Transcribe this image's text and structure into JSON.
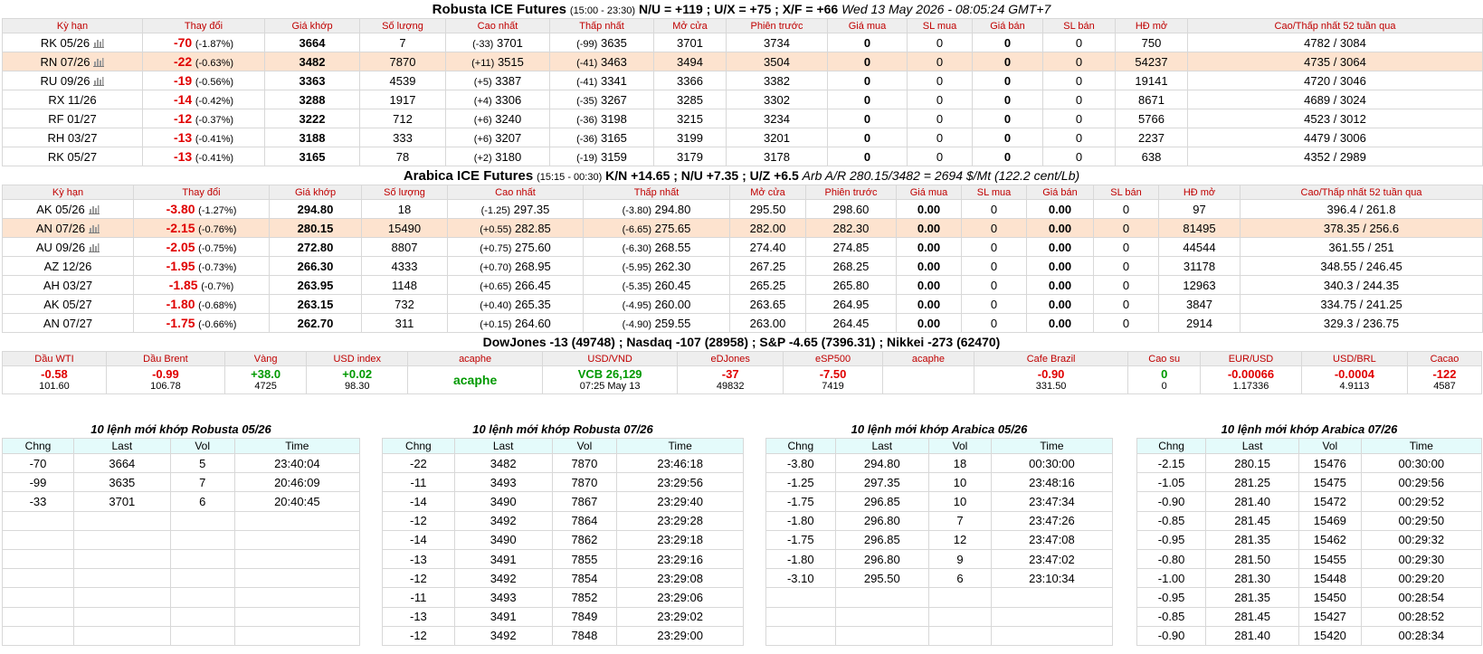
{
  "robusta": {
    "title": "Robusta ICE Futures",
    "hours": "(15:00 - 23:30)",
    "spreads": "N/U = +119 ; U/X = +75 ; X/F = +66",
    "datetime": "Wed 13 May 2026 - 08:05:24 GMT+7",
    "headers": [
      "Kỳ hạn",
      "Thay đổi",
      "Giá khớp",
      "Số lượng",
      "Cao nhất",
      "Thấp nhất",
      "Mở cửa",
      "Phiên trước",
      "Giá mua",
      "SL mua",
      "Giá bán",
      "SL bán",
      "HĐ mở",
      "Cao/Thấp nhất 52 tuần qua"
    ],
    "rows": [
      {
        "term": "RK 05/26",
        "chart": true,
        "chg": "-70",
        "pct": "(-1.87%)",
        "last": "3664",
        "vol": "7",
        "high_d": "(-33)",
        "high": "3701",
        "low_d": "(-99)",
        "low": "3635",
        "open": "3701",
        "prev": "3734",
        "bid": "0",
        "bid_qty": "0",
        "ask": "0",
        "ask_qty": "0",
        "oi": "750",
        "range": "4782 / 3084"
      },
      {
        "term": "RN 07/26",
        "chart": true,
        "chg": "-22",
        "pct": "(-0.63%)",
        "last": "3482",
        "vol": "7870",
        "high_d": "(+11)",
        "high": "3515",
        "low_d": "(-41)",
        "low": "3463",
        "open": "3494",
        "prev": "3504",
        "bid": "0",
        "bid_qty": "0",
        "ask": "0",
        "ask_qty": "0",
        "oi": "54237",
        "range": "4735 / 3064"
      },
      {
        "term": "RU 09/26",
        "chart": true,
        "chg": "-19",
        "pct": "(-0.56%)",
        "last": "3363",
        "vol": "4539",
        "high_d": "(+5)",
        "high": "3387",
        "low_d": "(-41)",
        "low": "3341",
        "open": "3366",
        "prev": "3382",
        "bid": "0",
        "bid_qty": "0",
        "ask": "0",
        "ask_qty": "0",
        "oi": "19141",
        "range": "4720 / 3046"
      },
      {
        "term": "RX 11/26",
        "chart": false,
        "chg": "-14",
        "pct": "(-0.42%)",
        "last": "3288",
        "vol": "1917",
        "high_d": "(+4)",
        "high": "3306",
        "low_d": "(-35)",
        "low": "3267",
        "open": "3285",
        "prev": "3302",
        "bid": "0",
        "bid_qty": "0",
        "ask": "0",
        "ask_qty": "0",
        "oi": "8671",
        "range": "4689 / 3024"
      },
      {
        "term": "RF 01/27",
        "chart": false,
        "chg": "-12",
        "pct": "(-0.37%)",
        "last": "3222",
        "vol": "712",
        "high_d": "(+6)",
        "high": "3240",
        "low_d": "(-36)",
        "low": "3198",
        "open": "3215",
        "prev": "3234",
        "bid": "0",
        "bid_qty": "0",
        "ask": "0",
        "ask_qty": "0",
        "oi": "5766",
        "range": "4523 / 3012"
      },
      {
        "term": "RH 03/27",
        "chart": false,
        "chg": "-13",
        "pct": "(-0.41%)",
        "last": "3188",
        "vol": "333",
        "high_d": "(+6)",
        "high": "3207",
        "low_d": "(-36)",
        "low": "3165",
        "open": "3199",
        "prev": "3201",
        "bid": "0",
        "bid_qty": "0",
        "ask": "0",
        "ask_qty": "0",
        "oi": "2237",
        "range": "4479 / 3006"
      },
      {
        "term": "RK 05/27",
        "chart": false,
        "chg": "-13",
        "pct": "(-0.41%)",
        "last": "3165",
        "vol": "78",
        "high_d": "(+2)",
        "high": "3180",
        "low_d": "(-19)",
        "low": "3159",
        "open": "3179",
        "prev": "3178",
        "bid": "0",
        "bid_qty": "0",
        "ask": "0",
        "ask_qty": "0",
        "oi": "638",
        "range": "4352 / 2989"
      }
    ]
  },
  "arabica": {
    "title": "Arabica ICE Futures",
    "hours": "(15:15 - 00:30)",
    "spreads": "K/N +14.65 ; N/U +7.35 ; U/Z +6.5",
    "arb": "Arb A/R 280.15/3482 = 2694 $/Mt (122.2 cent/Lb)",
    "headers": [
      "Kỳ hạn",
      "Thay đổi",
      "Giá khớp",
      "Số lượng",
      "Cao nhất",
      "Thấp nhất",
      "Mở cửa",
      "Phiên trước",
      "Giá mua",
      "SL mua",
      "Giá bán",
      "SL bán",
      "HĐ mở",
      "Cao/Thấp nhất 52 tuần qua"
    ],
    "rows": [
      {
        "term": "AK 05/26",
        "chart": true,
        "chg": "-3.80",
        "pct": "(-1.27%)",
        "last": "294.80",
        "vol": "18",
        "high_d": "(-1.25)",
        "high": "297.35",
        "low_d": "(-3.80)",
        "low": "294.80",
        "open": "295.50",
        "prev": "298.60",
        "bid": "0.00",
        "bid_qty": "0",
        "ask": "0.00",
        "ask_qty": "0",
        "oi": "97",
        "range": "396.4 / 261.8"
      },
      {
        "term": "AN 07/26",
        "chart": true,
        "chg": "-2.15",
        "pct": "(-0.76%)",
        "last": "280.15",
        "vol": "15490",
        "high_d": "(+0.55)",
        "high": "282.85",
        "low_d": "(-6.65)",
        "low": "275.65",
        "open": "282.00",
        "prev": "282.30",
        "bid": "0.00",
        "bid_qty": "0",
        "ask": "0.00",
        "ask_qty": "0",
        "oi": "81495",
        "range": "378.35 / 256.6"
      },
      {
        "term": "AU 09/26",
        "chart": true,
        "chg": "-2.05",
        "pct": "(-0.75%)",
        "last": "272.80",
        "vol": "8807",
        "high_d": "(+0.75)",
        "high": "275.60",
        "low_d": "(-6.30)",
        "low": "268.55",
        "open": "274.40",
        "prev": "274.85",
        "bid": "0.00",
        "bid_qty": "0",
        "ask": "0.00",
        "ask_qty": "0",
        "oi": "44544",
        "range": "361.55 / 251"
      },
      {
        "term": "AZ 12/26",
        "chart": false,
        "chg": "-1.95",
        "pct": "(-0.73%)",
        "last": "266.30",
        "vol": "4333",
        "high_d": "(+0.70)",
        "high": "268.95",
        "low_d": "(-5.95)",
        "low": "262.30",
        "open": "267.25",
        "prev": "268.25",
        "bid": "0.00",
        "bid_qty": "0",
        "ask": "0.00",
        "ask_qty": "0",
        "oi": "31178",
        "range": "348.55 / 246.45"
      },
      {
        "term": "AH 03/27",
        "chart": false,
        "chg": "-1.85",
        "pct": "(-0.7%)",
        "last": "263.95",
        "vol": "1148",
        "high_d": "(+0.65)",
        "high": "266.45",
        "low_d": "(-5.35)",
        "low": "260.45",
        "open": "265.25",
        "prev": "265.80",
        "bid": "0.00",
        "bid_qty": "0",
        "ask": "0.00",
        "ask_qty": "0",
        "oi": "12963",
        "range": "340.3 / 244.35"
      },
      {
        "term": "AK 05/27",
        "chart": false,
        "chg": "-1.80",
        "pct": "(-0.68%)",
        "last": "263.15",
        "vol": "732",
        "high_d": "(+0.40)",
        "high": "265.35",
        "low_d": "(-4.95)",
        "low": "260.00",
        "open": "263.65",
        "prev": "264.95",
        "bid": "0.00",
        "bid_qty": "0",
        "ask": "0.00",
        "ask_qty": "0",
        "oi": "3847",
        "range": "334.75 / 241.25"
      },
      {
        "term": "AN 07/27",
        "chart": false,
        "chg": "-1.75",
        "pct": "(-0.66%)",
        "last": "262.70",
        "vol": "311",
        "high_d": "(+0.15)",
        "high": "264.60",
        "low_d": "(-4.90)",
        "low": "259.55",
        "open": "263.00",
        "prev": "264.45",
        "bid": "0.00",
        "bid_qty": "0",
        "ask": "0.00",
        "ask_qty": "0",
        "oi": "2914",
        "range": "329.3 / 236.75"
      }
    ]
  },
  "indices_line": "DowJones -13 (49748) ; Nasdaq -107 (28958) ; S&P -4.65 (7396.31) ; Nikkei -273 (62470)",
  "markets": [
    {
      "name": "Dầu WTI",
      "value": "-0.58",
      "sub": "101.60",
      "color": "red"
    },
    {
      "name": "Dầu Brent",
      "value": "-0.99",
      "sub": "106.78",
      "color": "red"
    },
    {
      "name": "Vàng",
      "value": "+38.0",
      "sub": "4725",
      "color": "green"
    },
    {
      "name": "USD index",
      "value": "+0.02",
      "sub": "98.30",
      "color": "green"
    },
    {
      "name": "acaphe",
      "value": "acaphe",
      "sub": "",
      "color": "green"
    },
    {
      "name": "USD/VND",
      "value": "VCB 26,129",
      "sub": "07:25 May 13",
      "color": "green"
    },
    {
      "name": "eDJones",
      "value": "-37",
      "sub": "49832",
      "color": "red"
    },
    {
      "name": "eSP500",
      "value": "-7.50",
      "sub": "7419",
      "color": "red"
    },
    {
      "name": "acaphe",
      "value": "",
      "sub": "",
      "color": "green"
    },
    {
      "name": "Cafe Brazil",
      "value": "-0.90",
      "sub": "331.50",
      "color": "red"
    },
    {
      "name": "Cao su",
      "value": "0",
      "sub": "0",
      "color": "green"
    },
    {
      "name": "EUR/USD",
      "value": "-0.00066",
      "sub": "1.17336",
      "color": "red"
    },
    {
      "name": "USD/BRL",
      "value": "-0.0004",
      "sub": "4.9113",
      "color": "red"
    },
    {
      "name": "Cacao",
      "value": "-122",
      "sub": "4587",
      "color": "red"
    }
  ],
  "ticks": [
    {
      "caption": "10 lệnh mới khớp Robusta 05/26",
      "headers": [
        "Chng",
        "Last",
        "Vol",
        "Time"
      ],
      "rows": [
        [
          "-70",
          "3664",
          "5",
          "23:40:04"
        ],
        [
          "-99",
          "3635",
          "7",
          "20:46:09"
        ],
        [
          "-33",
          "3701",
          "6",
          "20:40:45"
        ],
        [
          "",
          "",
          "",
          ""
        ],
        [
          "",
          "",
          "",
          ""
        ],
        [
          "",
          "",
          "",
          ""
        ],
        [
          "",
          "",
          "",
          ""
        ],
        [
          "",
          "",
          "",
          ""
        ],
        [
          "",
          "",
          "",
          ""
        ],
        [
          "",
          "",
          "",
          ""
        ]
      ]
    },
    {
      "caption": "10 lệnh mới khớp Robusta 07/26",
      "headers": [
        "Chng",
        "Last",
        "Vol",
        "Time"
      ],
      "rows": [
        [
          "-22",
          "3482",
          "7870",
          "23:46:18"
        ],
        [
          "-11",
          "3493",
          "7870",
          "23:29:56"
        ],
        [
          "-14",
          "3490",
          "7867",
          "23:29:40"
        ],
        [
          "-12",
          "3492",
          "7864",
          "23:29:28"
        ],
        [
          "-14",
          "3490",
          "7862",
          "23:29:18"
        ],
        [
          "-13",
          "3491",
          "7855",
          "23:29:16"
        ],
        [
          "-12",
          "3492",
          "7854",
          "23:29:08"
        ],
        [
          "-11",
          "3493",
          "7852",
          "23:29:06"
        ],
        [
          "-13",
          "3491",
          "7849",
          "23:29:02"
        ],
        [
          "-12",
          "3492",
          "7848",
          "23:29:00"
        ]
      ]
    },
    {
      "caption": "10 lệnh mới khớp Arabica 05/26",
      "headers": [
        "Chng",
        "Last",
        "Vol",
        "Time"
      ],
      "rows": [
        [
          "-3.80",
          "294.80",
          "18",
          "00:30:00"
        ],
        [
          "-1.25",
          "297.35",
          "10",
          "23:48:16"
        ],
        [
          "-1.75",
          "296.85",
          "10",
          "23:47:34"
        ],
        [
          "-1.80",
          "296.80",
          "7",
          "23:47:26"
        ],
        [
          "-1.75",
          "296.85",
          "12",
          "23:47:08"
        ],
        [
          "-1.80",
          "296.80",
          "9",
          "23:47:02"
        ],
        [
          "-3.10",
          "295.50",
          "6",
          "23:10:34"
        ],
        [
          "",
          "",
          "",
          ""
        ],
        [
          "",
          "",
          "",
          ""
        ],
        [
          "",
          "",
          "",
          ""
        ]
      ]
    },
    {
      "caption": "10 lệnh mới khớp Arabica 07/26",
      "headers": [
        "Chng",
        "Last",
        "Vol",
        "Time"
      ],
      "rows": [
        [
          "-2.15",
          "280.15",
          "15476",
          "00:30:00"
        ],
        [
          "-1.05",
          "281.25",
          "15475",
          "00:29:56"
        ],
        [
          "-0.90",
          "281.40",
          "15472",
          "00:29:52"
        ],
        [
          "-0.85",
          "281.45",
          "15469",
          "00:29:50"
        ],
        [
          "-0.95",
          "281.35",
          "15462",
          "00:29:32"
        ],
        [
          "-0.80",
          "281.50",
          "15455",
          "00:29:30"
        ],
        [
          "-1.00",
          "281.30",
          "15448",
          "00:29:20"
        ],
        [
          "-0.95",
          "281.35",
          "15450",
          "00:28:54"
        ],
        [
          "-0.85",
          "281.45",
          "15427",
          "00:28:52"
        ],
        [
          "-0.90",
          "281.40",
          "15420",
          "00:28:34"
        ]
      ]
    }
  ]
}
